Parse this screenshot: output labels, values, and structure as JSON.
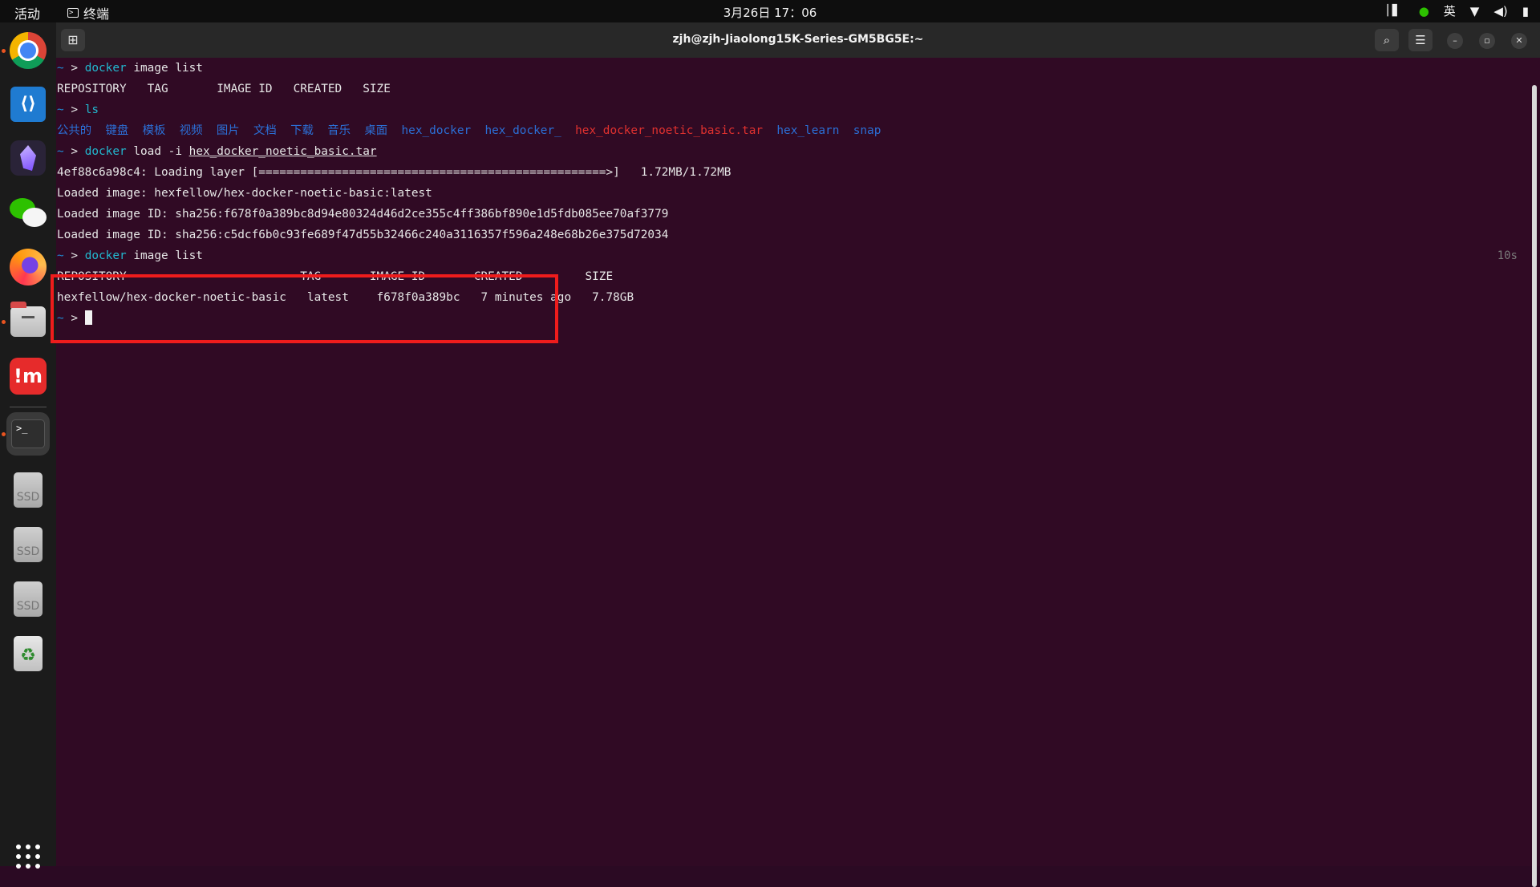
{
  "topbar": {
    "activities": "活动",
    "app_name": "终端",
    "clock": "3月26日 17：06",
    "input_method": "英"
  },
  "dock": {
    "items": [
      {
        "name": "chrome",
        "running": true
      },
      {
        "name": "vscode",
        "running": false
      },
      {
        "name": "obsidian",
        "running": false
      },
      {
        "name": "wechat",
        "running": false
      },
      {
        "name": "firefox",
        "running": false
      },
      {
        "name": "files",
        "running": true
      },
      {
        "name": "mm",
        "running": false,
        "label": "!m"
      },
      {
        "name": "terminal",
        "running": true,
        "label": ">_"
      },
      {
        "name": "ssd-1",
        "label": "SSD"
      },
      {
        "name": "ssd-2",
        "label": "SSD"
      },
      {
        "name": "ssd-3",
        "label": "SSD"
      },
      {
        "name": "trash",
        "label": "♻"
      }
    ]
  },
  "window": {
    "title": "zjh@zjh-Jiaolong15K-Series-GM5BG5E:~",
    "duration": "10s"
  },
  "prompt": {
    "tilde": "~",
    "arrow": ">"
  },
  "terminal": {
    "cmd1": {
      "cmd": "docker",
      "rest": " image list"
    },
    "header1": "REPOSITORY   TAG       IMAGE ID   CREATED   SIZE",
    "cmd2": {
      "cmd": "ls"
    },
    "ls_dirs": [
      "公共的",
      "键盘",
      "模板",
      "视频",
      "图片",
      "文档",
      "下载",
      "音乐",
      "桌面",
      "hex_docker",
      "hex_docker_"
    ],
    "ls_red": "hex_docker_noetic_basic.tar",
    "ls_dirs2": [
      "hex_learn",
      "snap"
    ],
    "cmd3": {
      "cmd": "docker",
      "rest": " load -i ",
      "arg": "hex_docker_noetic_basic.tar"
    },
    "out1": "4ef88c6a98c4: Loading layer [==================================================>]   1.72MB/1.72MB",
    "out2": "Loaded image: hexfellow/hex-docker-noetic-basic:latest",
    "out3": "Loaded image ID: sha256:f678f0a389bc8d94e80324d46d2ce355c4ff386bf890e1d5fdb085ee70af3779",
    "out4": "Loaded image ID: sha256:c5dcf6b0c93fe689f47d55b32466c240a3116357f596a248e68b26e375d72034",
    "cmd4": {
      "cmd": "docker",
      "rest": " image list"
    },
    "header2": "REPOSITORY                         TAG       IMAGE ID       CREATED         SIZE",
    "row": "hexfellow/hex-docker-noetic-basic   latest    f678f0a389bc   7 minutes ago   7.78GB"
  },
  "colors": {
    "background": "#300a24",
    "highlight_box": "#ee1c1c",
    "prompt": "#1f8ad2",
    "command": "#22b8cf",
    "directory": "#2b6fd6",
    "archive": "#e0312f"
  }
}
